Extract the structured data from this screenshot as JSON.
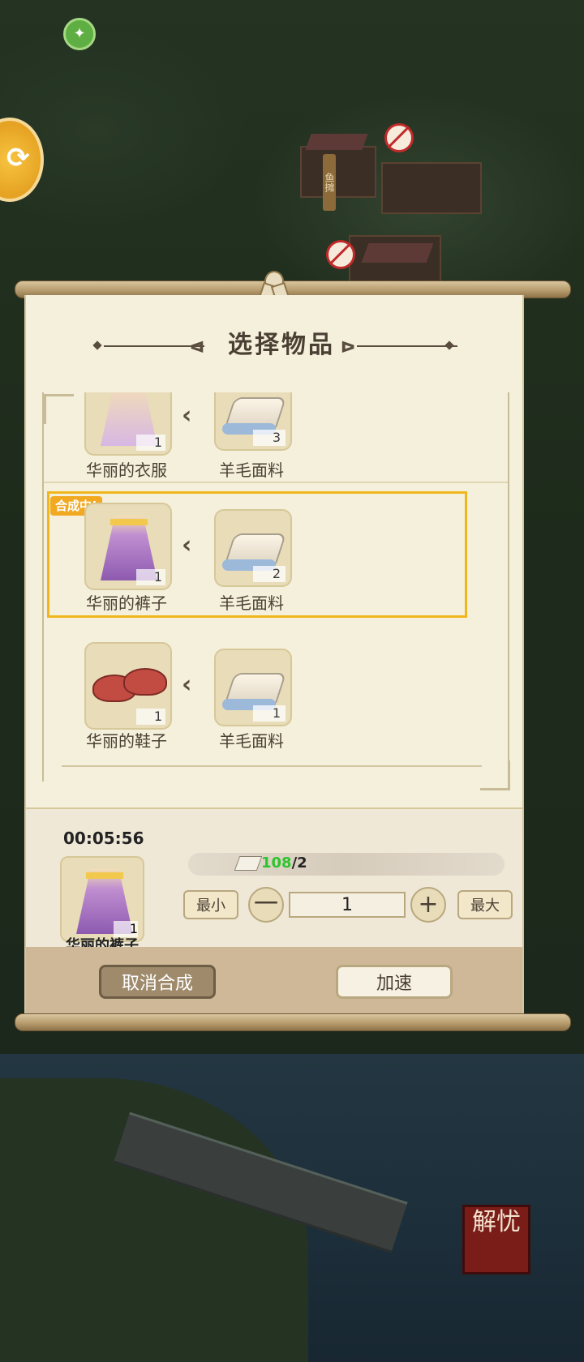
{
  "background": {
    "stall_sign": "鱼摊",
    "stall_sign2": "鱼",
    "corner_logo": "解忧"
  },
  "panel": {
    "title": "选择物品",
    "recipes": [
      {
        "item_name": "华丽的衣服",
        "item_count": "1",
        "material_name": "羊毛面料",
        "material_count": "3"
      },
      {
        "item_name": "华丽的裤子",
        "item_count": "1",
        "material_name": "羊毛面料",
        "material_count": "2",
        "badge": "合成中!"
      },
      {
        "item_name": "华丽的鞋子",
        "item_count": "1",
        "material_name": "羊毛面料",
        "material_count": "1"
      }
    ],
    "current": {
      "timer": "00:05:56",
      "item_name": "华丽的裤子",
      "item_count": "1",
      "stock_have": "108",
      "stock_need": "/2"
    },
    "controls": {
      "min_label": "最小",
      "max_label": "最大",
      "minus": "一",
      "plus": "+",
      "quantity": "1"
    },
    "buttons": {
      "cancel": "取消合成",
      "speed_up": "加速"
    }
  },
  "colors": {
    "highlight": "#f0b71c",
    "stock_green": "#2ec42e"
  }
}
